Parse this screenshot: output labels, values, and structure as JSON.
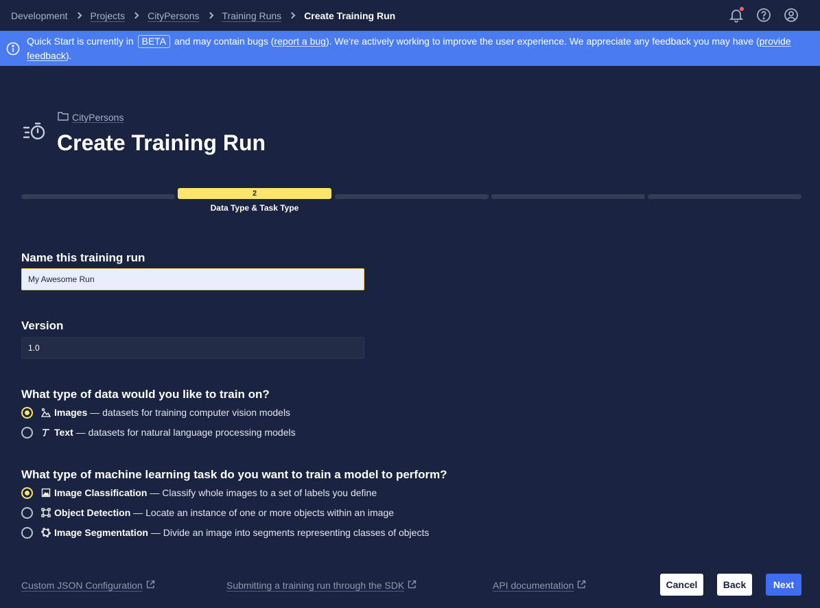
{
  "breadcrumbs": [
    {
      "label": "Development"
    },
    {
      "label": "Projects"
    },
    {
      "label": "CityPersons"
    },
    {
      "label": "Training Runs"
    },
    {
      "label": "Create Training Run"
    }
  ],
  "banner": {
    "text1": "Quick Start is currently in",
    "beta": "BETA",
    "text2": "and may contain bugs (",
    "report_link": "report a bug",
    "text3": "). We're actively working to improve the user experience. We appreciate any feedback you may have (",
    "feedback_link": "provide feedback",
    "text4": ")."
  },
  "header": {
    "project": "CityPersons",
    "title": "Create Training Run"
  },
  "stepper": {
    "current_step": "2",
    "current_label": "Data Type & Task Type"
  },
  "form": {
    "name_label": "Name this training run",
    "name_value": "My Awesome Run",
    "version_label": "Version",
    "version_value": "1.0",
    "data_type_question": "What type of data would you like to train on?",
    "data_types": [
      {
        "title": "Images",
        "desc": "— datasets for training computer vision models",
        "checked": true
      },
      {
        "title": "Text",
        "desc": "— datasets for natural language processing models",
        "checked": false
      }
    ],
    "task_question": "What type of machine learning task do you want to train a model to perform?",
    "tasks": [
      {
        "title": "Image Classification",
        "desc": "— Classify whole images to a set of labels you define",
        "checked": true
      },
      {
        "title": "Object Detection",
        "desc": "— Locate an instance of one or more objects within an image",
        "checked": false
      },
      {
        "title": "Image Segmentation",
        "desc": "— Divide an image into segments representing classes of objects",
        "checked": false
      }
    ]
  },
  "footer": {
    "links": [
      {
        "label": "Custom JSON Configuration"
      },
      {
        "label": "Submitting a training run through the SDK"
      },
      {
        "label": "API documentation"
      }
    ],
    "cancel": "Cancel",
    "back": "Back",
    "next": "Next"
  },
  "colors": {
    "background": "#1a2340",
    "banner": "#4a7bf0",
    "accent_yellow": "#fde46b",
    "primary_button": "#3f6df2"
  },
  "icons": [
    "chevron-right-icon",
    "bell-icon",
    "help-icon",
    "user-icon",
    "info-icon",
    "stopwatch-icon",
    "folder-icon",
    "images-icon",
    "text-icon",
    "image-icon",
    "bounding-box-icon",
    "segmentation-icon",
    "external-link-icon"
  ]
}
